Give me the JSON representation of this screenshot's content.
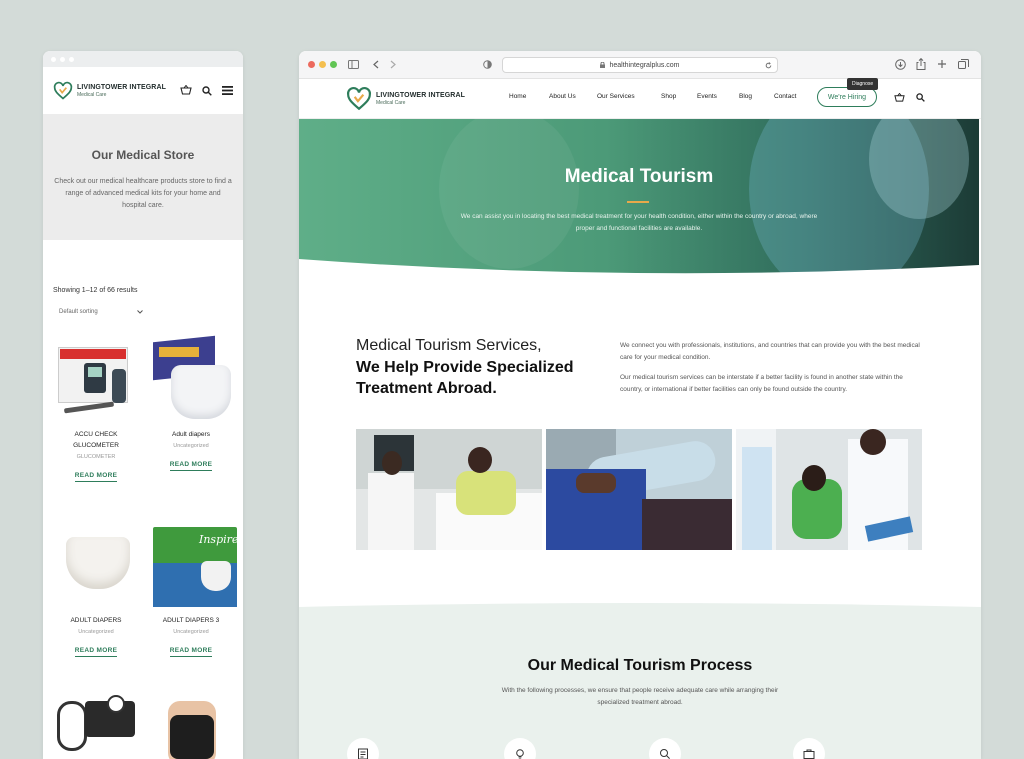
{
  "brand": {
    "name": "LIVINGTOWER INTEGRAL",
    "subtitle": "Medical Care"
  },
  "mobile": {
    "store_title": "Our Medical Store",
    "store_desc": "Check out our medical healthcare products store to find a range of advanced medical kits for your home and hospital care.",
    "showing": "Showing 1–12 of 66 results",
    "sort_label": "Default sorting",
    "products": [
      {
        "name": "ACCU CHECK GLUCOMETER",
        "category": "GLUCOMETER",
        "button": "READ MORE"
      },
      {
        "name": "Adult diapers",
        "category": "Uncategorized",
        "button": "READ MORE"
      },
      {
        "name": "ADULT DIAPERS",
        "category": "Uncategorized",
        "button": "READ MORE"
      },
      {
        "name": "ADULT DIAPERS 3",
        "category": "Uncategorized",
        "button": "READ MORE"
      }
    ]
  },
  "browser": {
    "url": "healthintegralplus.com",
    "nav": [
      "Home",
      "About Us",
      "Our Services",
      "Shop",
      "Events",
      "Blog",
      "Contact"
    ],
    "hire_button": "We're Hiring",
    "tooltip": "Diagnose",
    "hero": {
      "title": "Medical Tourism",
      "text": "We can assist you in locating the best medical treatment for your health condition, either within the country or abroad, where proper and functional facilities are available."
    },
    "services": {
      "title_light": "Medical Tourism Services,",
      "title_bold": "We Help Provide Specialized Treatment Abroad.",
      "para1": "We connect you with professionals, institutions, and countries that can provide you with the best medical care for your medical condition.",
      "para2": "Our medical tourism services can be interstate if a better facility is found in another state within the country, or international if better facilities can only be found outside the country."
    },
    "process": {
      "title": "Our Medical Tourism Process",
      "text": "With the following processes, we ensure that people receive adequate care while arranging their specialized treatment abroad."
    }
  },
  "colors": {
    "brand_green": "#2e7d5b",
    "hero_green": "#5fae88",
    "process_bg": "#eaf1ed"
  }
}
